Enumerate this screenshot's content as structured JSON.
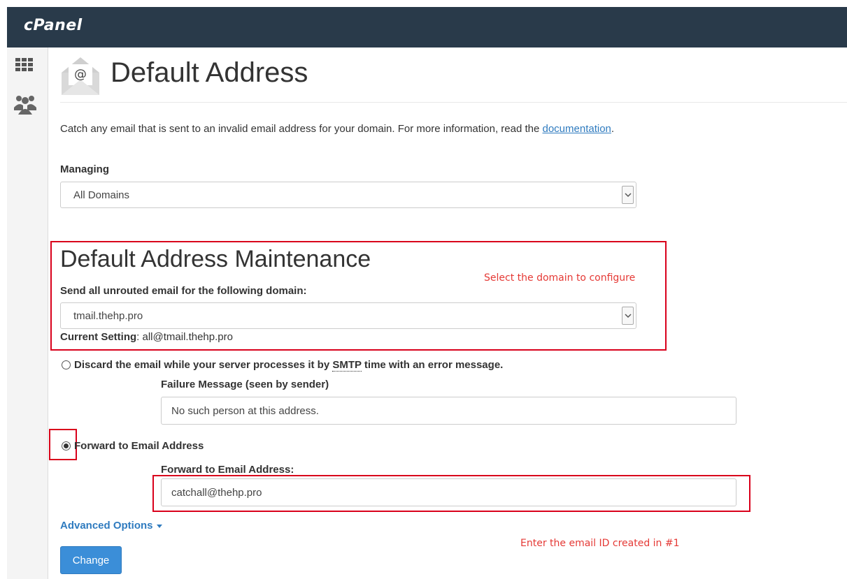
{
  "header": {
    "logo_text": "cPanel"
  },
  "sidebar": {
    "items": [
      {
        "icon": "grid-icon"
      },
      {
        "icon": "users-icon"
      }
    ]
  },
  "page": {
    "icon": "email-envelope-icon",
    "title": "Default Address",
    "description_prefix": "Catch any email that is sent to an invalid email address for your domain. For more information, read the ",
    "description_link": "documentation",
    "description_suffix": "."
  },
  "managing": {
    "label": "Managing",
    "selected": "All Domains"
  },
  "maintenance": {
    "heading": "Default Address Maintenance",
    "domain_label": "Send all unrouted email for the following domain:",
    "domain_selected": "tmail.thehp.pro",
    "current_setting_label": "Current Setting",
    "current_setting_value": ": all@tmail.thehp.pro"
  },
  "options": {
    "discard_label_prefix": "Discard the email while your server processes it by ",
    "discard_label_smtp": "SMTP",
    "discard_label_suffix": " time with an error message.",
    "failure_label": "Failure Message (seen by sender)",
    "failure_value": "No such person at this address.",
    "forward_radio_label": "Forward to Email Address",
    "forward_field_label": "Forward to Email Address:",
    "forward_value": "catchall@thehp.pro",
    "selected_option": "forward"
  },
  "advanced_options_label": "Advanced Options",
  "change_button_label": "Change",
  "annotations": {
    "select_domain": "Select the domain to configure",
    "enter_email": "Enter the email ID created in #1",
    "color": "#e53935"
  },
  "colors": {
    "header_bg": "#293a4a",
    "link": "#2f7bbf",
    "primary_button": "#3b8ed8",
    "highlight_box": "#d9001b"
  }
}
